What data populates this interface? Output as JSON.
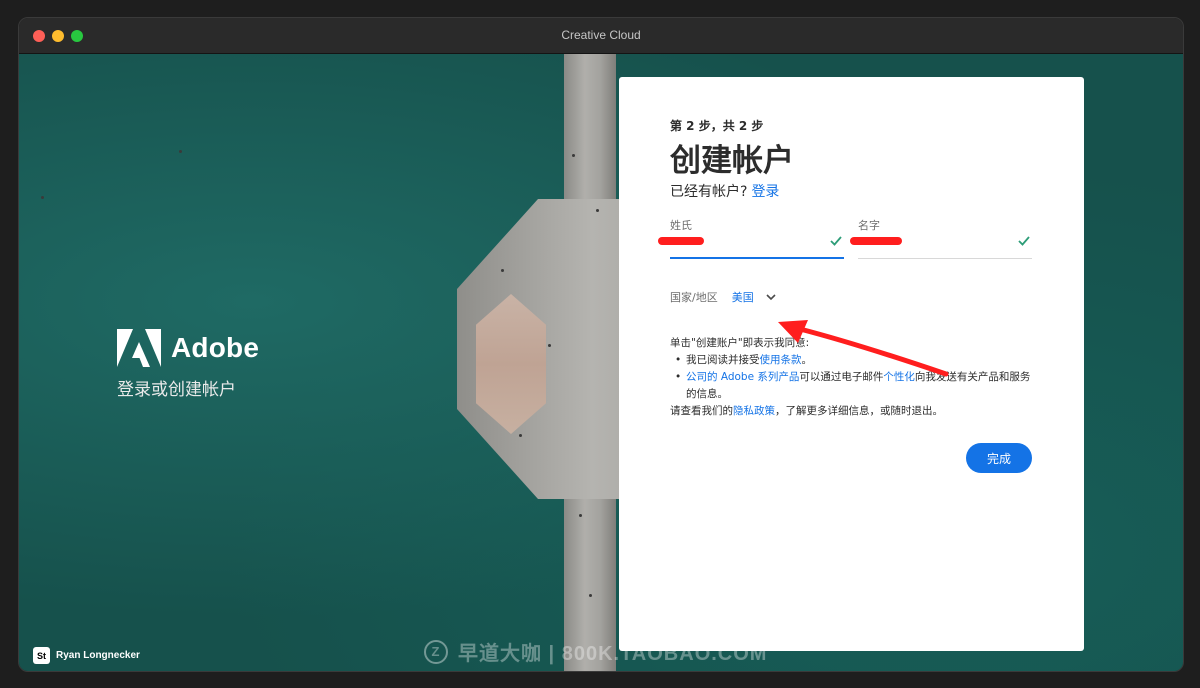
{
  "window": {
    "title": "Creative Cloud"
  },
  "brand": {
    "wordmark": "Adobe",
    "tagline": "登录或创建帐户"
  },
  "photo_credit": {
    "badge": "St",
    "name": "Ryan Longnecker"
  },
  "watermark": {
    "icon_glyph": "Z",
    "text": "早道大咖 | 800K.TAOBAO.COM"
  },
  "form": {
    "step": "第 2 步，共 2 步",
    "title": "创建帐户",
    "have_account": "已经有帐户?",
    "signin_link": "登录",
    "last_name_label": "姓氏",
    "first_name_label": "名字",
    "country_label": "国家/地区",
    "country_value": "美国",
    "terms_intro": "单击\"创建账户\"即表示我同意:",
    "terms_item1_text": "我已阅读并接受",
    "terms_item1_link": "使用条款",
    "terms_item1_end": "。",
    "terms_item2_link1": "公司的 Adobe 系列产品",
    "terms_item2_text1": "可以通过电子邮件",
    "terms_item2_link2": "个性化",
    "terms_item2_text2": "向我发送有关产品和服务的信息。",
    "privacy_text1": "请查看我们的",
    "privacy_link": "隐私政策",
    "privacy_text2": "，了解更多详细信息，或随时退出。",
    "done_button": "完成"
  },
  "colors": {
    "accent": "#1473e6",
    "check": "#2d9d78",
    "annotation": "#ff1e1e"
  }
}
